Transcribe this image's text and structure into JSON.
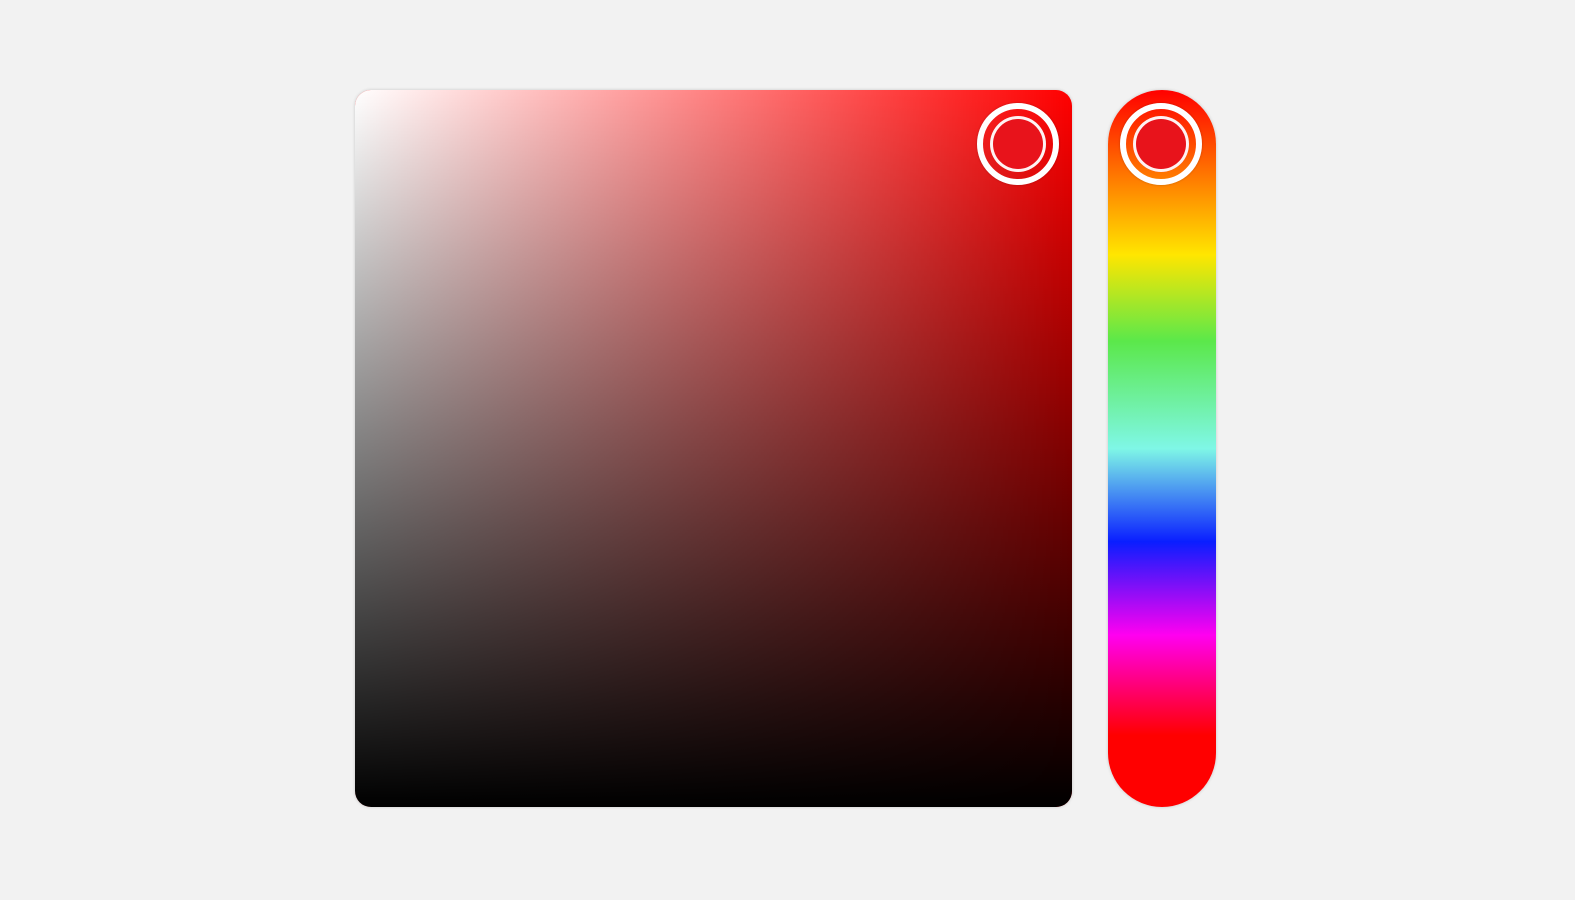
{
  "color_picker": {
    "selected_color": "#e8131b",
    "hue_color": "#ff0000",
    "hue_degrees": 0,
    "saturation": 0.95,
    "brightness": 0.93
  }
}
